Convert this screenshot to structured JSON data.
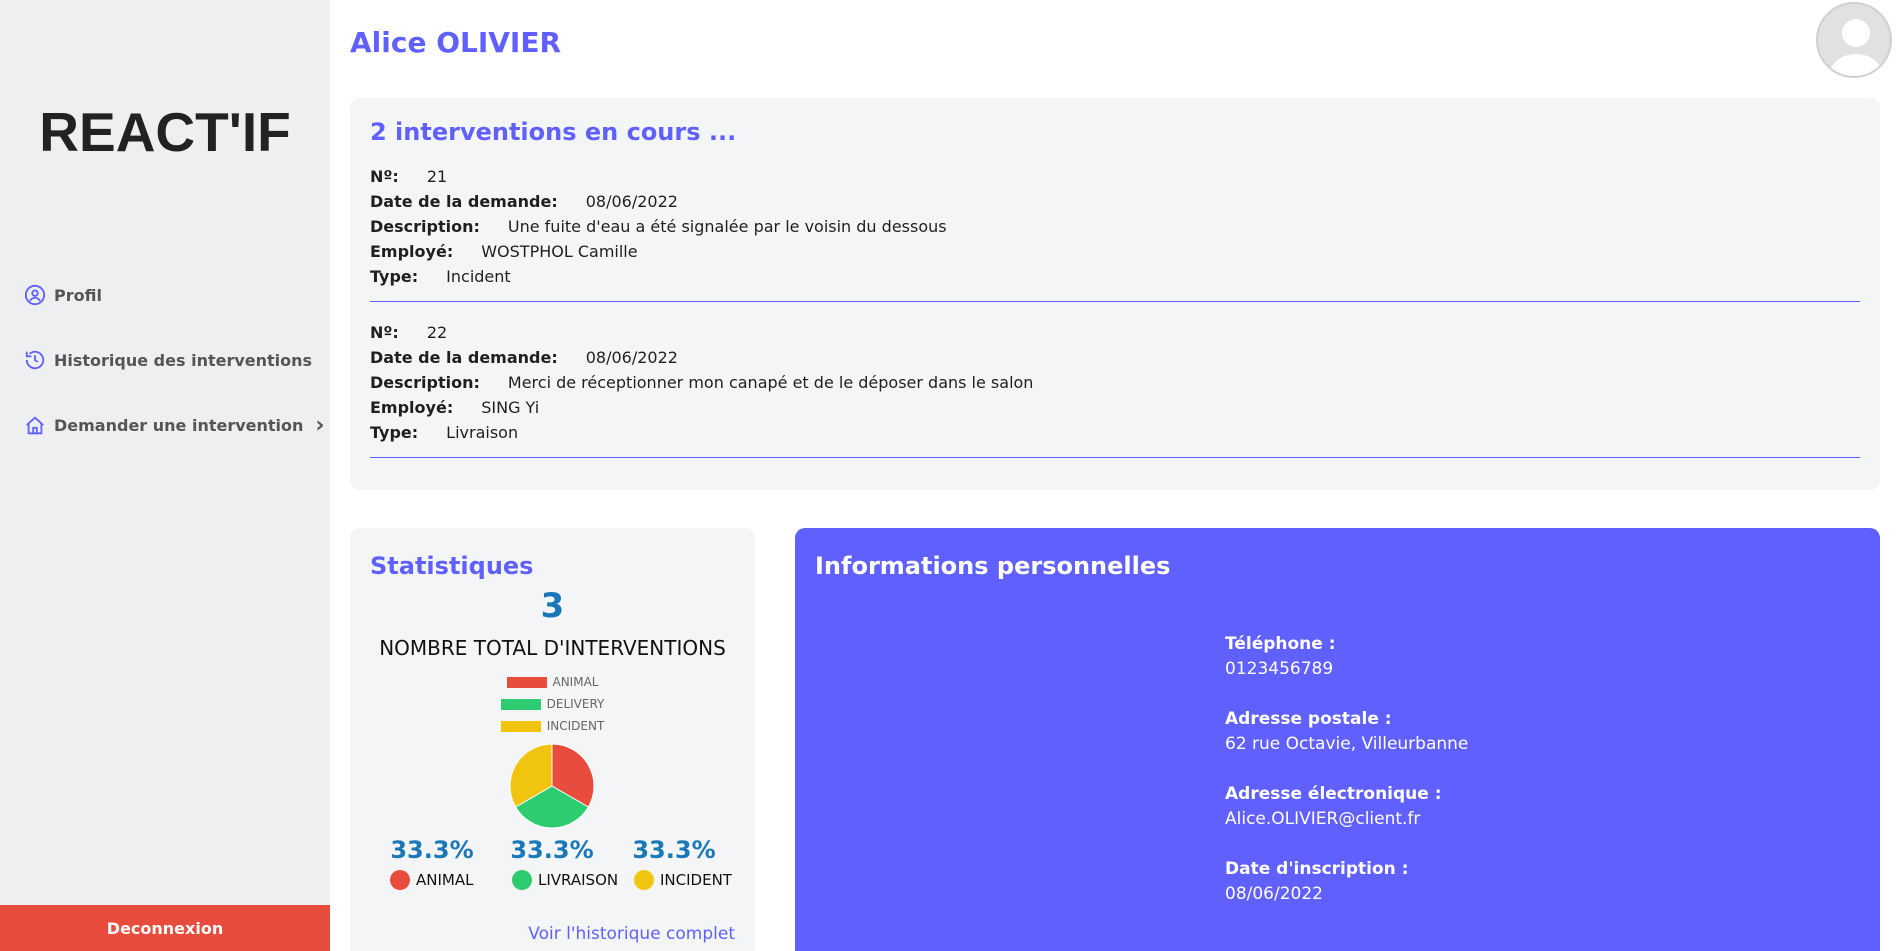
{
  "sidebar": {
    "logo": "REACT'IF",
    "items": [
      {
        "label": "Profil",
        "icon": "user-circle-icon"
      },
      {
        "label": "Historique des interventions",
        "icon": "history-icon"
      },
      {
        "label": "Demander une intervention",
        "icon": "home-icon",
        "chevron": "›"
      }
    ],
    "logout_label": "Deconnexion"
  },
  "header": {
    "user_name": "Alice OLIVIER"
  },
  "current": {
    "title": "2 interventions en cours ...",
    "labels": {
      "num": "Nº:",
      "date": "Date de la demande:",
      "description": "Description:",
      "employee": "Employé:",
      "type": "Type:"
    },
    "interventions": [
      {
        "num": "21",
        "date": "08/06/2022",
        "description": "Une fuite d'eau a été signalée par le voisin du dessous",
        "employee": "WOSTPHOL Camille",
        "type": "Incident"
      },
      {
        "num": "22",
        "date": "08/06/2022",
        "description": "Merci de réceptionner mon canapé et de le déposer dans le salon",
        "employee": "SING Yi",
        "type": "Livraison"
      }
    ]
  },
  "stats": {
    "title": "Statistiques",
    "total": "3",
    "total_label": "NOMBRE TOTAL D'INTERVENTIONS",
    "legend": [
      {
        "label": "ANIMAL",
        "color": "#e84c3d"
      },
      {
        "label": "DELIVERY",
        "color": "#2ecc71"
      },
      {
        "label": "INCIDENT",
        "color": "#f1c40f"
      }
    ],
    "percentages": [
      "33.3%",
      "33.3%",
      "33.3%"
    ],
    "categories": [
      {
        "label": "ANIMAL",
        "color": "#e84c3d"
      },
      {
        "label": "LIVRAISON",
        "color": "#2ecc71"
      },
      {
        "label": "INCIDENT",
        "color": "#f1c40f"
      }
    ],
    "history_link": "Voir l'historique complet"
  },
  "chart_data": {
    "type": "pie",
    "categories": [
      "ANIMAL",
      "DELIVERY",
      "INCIDENT"
    ],
    "values": [
      1,
      1,
      1
    ],
    "colors": [
      "#e84c3d",
      "#2ecc71",
      "#f1c40f"
    ]
  },
  "info": {
    "title": "Informations personnelles",
    "phone_label": "Téléphone :",
    "phone": "0123456789",
    "address_label": "Adresse postale :",
    "address": "62 rue Octavie, Villeurbanne",
    "email_label": "Adresse électronique :",
    "email": "Alice.OLIVIER@client.fr",
    "date_label": "Date d'inscription :",
    "date": "08/06/2022"
  }
}
